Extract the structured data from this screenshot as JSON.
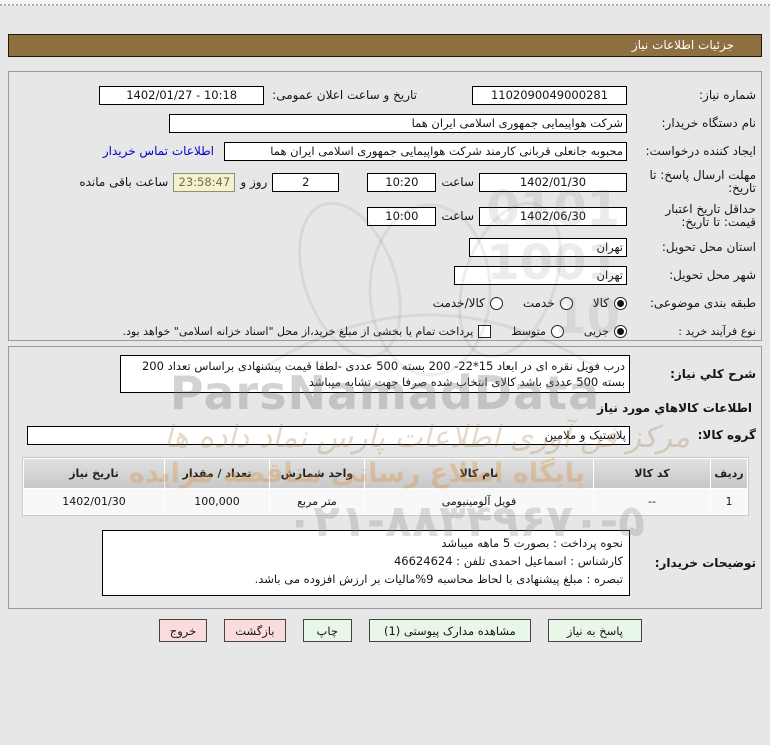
{
  "page": {
    "title_bar": "جزئیات اطلاعات نیاز"
  },
  "info_panel": {
    "need_number": {
      "label": "شماره نیاز:",
      "value": "1102090049000281"
    },
    "announce": {
      "label": "تاریخ و ساعت اعلان عمومی:",
      "value": "1402/01/27 - 10:18"
    },
    "buyer_org": {
      "label": "نام دستگاه خریدار:",
      "value": "شرکت هواپیمایی جمهوری اسلامی ایران هما"
    },
    "creator": {
      "label": "ایجاد کننده درخواست:",
      "value": "محبوبه جانعلی قربانی کارمند شرکت هواپیمایی جمهوری اسلامی ایران هما",
      "contact_link": "اطلاعات تماس خریدار"
    },
    "deadline": {
      "label": "مهلت ارسال پاسخ: تا تاریخ:",
      "date": "1402/01/30",
      "hour_label": "ساعت",
      "time": "10:20",
      "days": "2",
      "days_label": "روز و",
      "countdown": "23:58:47",
      "countdown_label": "ساعت باقی مانده"
    },
    "validity": {
      "label": "حداقل تاریخ اعتبار قیمت: تا تاریخ:",
      "date": "1402/06/30",
      "hour_label": "ساعت",
      "time": "10:00"
    },
    "province": {
      "label": "استان محل تحویل:",
      "value": "تهران"
    },
    "city": {
      "label": "شهر محل تحویل:",
      "value": "تهران"
    },
    "subject_class": {
      "label": "طبقه بندی موضوعی:",
      "options": [
        {
          "label": "کالا",
          "selected": true
        },
        {
          "label": "خدمت",
          "selected": false
        },
        {
          "label": "کالا/خدمت",
          "selected": false
        }
      ]
    },
    "process_type": {
      "label": "نوع فرآیند خرید :",
      "options": [
        {
          "label": "جزیی",
          "selected": true
        },
        {
          "label": "متوسط",
          "selected": false
        }
      ],
      "treasury_checkbox": {
        "label": "پرداخت تمام یا بخشی از مبلغ خرید،از محل \"اسناد خزانه اسلامی\" خواهد بود.",
        "checked": false
      }
    }
  },
  "need_panel": {
    "description": {
      "label": "شرح کلي نیاز:",
      "value": "درب فویل نقره ای در ابعاد 15*22- 200 بسته 500 عددی -لطفا قیمت پیشنهادی براساس تعداد 200 بسته 500 عددی باشد کالای انتخاب شده صرفا جهت تشابه میباشد"
    },
    "goods_heading": "اطلاعات کالاهاي مورد نیاز",
    "goods_group": {
      "label": "گروه کالا:",
      "value": "پلاستیک و ملامین"
    },
    "table": {
      "headers": [
        "ردیف",
        "کد کالا",
        "نام کالا",
        "واحد شمارش",
        "تعداد / مقدار",
        "تاریخ نیاز"
      ],
      "rows": [
        [
          "1",
          "--",
          "فویل آلومینیومی",
          "متر مربع",
          "100,000",
          "1402/01/30"
        ]
      ]
    },
    "buyer_notes": {
      "label": "توضیحات خریدار:",
      "lines": [
        "نحوه پرداخت : بصورت 5 ماهه میباشد",
        "کارشناس : اسماعیل احمدی تلفن : 46624624",
        "تبصره : مبلغ پیشنهادی با لحاظ محاسبه 9%مالیات بر ارزش افزوده می باشد."
      ]
    }
  },
  "buttons": [
    {
      "label": "پاسخ به نیاز",
      "style": "green"
    },
    {
      "label": "مشاهده مدارک پیوستی (1)",
      "style": "green"
    },
    {
      "label": "چاپ",
      "style": "green"
    },
    {
      "label": "بازگشت",
      "style": "pink"
    },
    {
      "label": "خروج",
      "style": "pink"
    }
  ],
  "watermark": {
    "brand": "ParsNamadData",
    "fa_line1": "مرکز فن آوری اطلاعات پارس نماد داده ها",
    "fa_line2": "پایگاه اطلاع رسانی مناقصه مزایده",
    "phone": "۰۲۱-۸۸۳۴۹۶۷۰-۵",
    "digits_1": "0101",
    "digits_2": "1001",
    "digits_3": "10"
  },
  "colors": {
    "titlebar_bg": "#8d6f40",
    "button_green_bg": "#e9f7e9",
    "button_pink_bg": "#fbdcdc",
    "countdown_bg": "#f5f1cd",
    "link_blue": "#0000cc"
  }
}
